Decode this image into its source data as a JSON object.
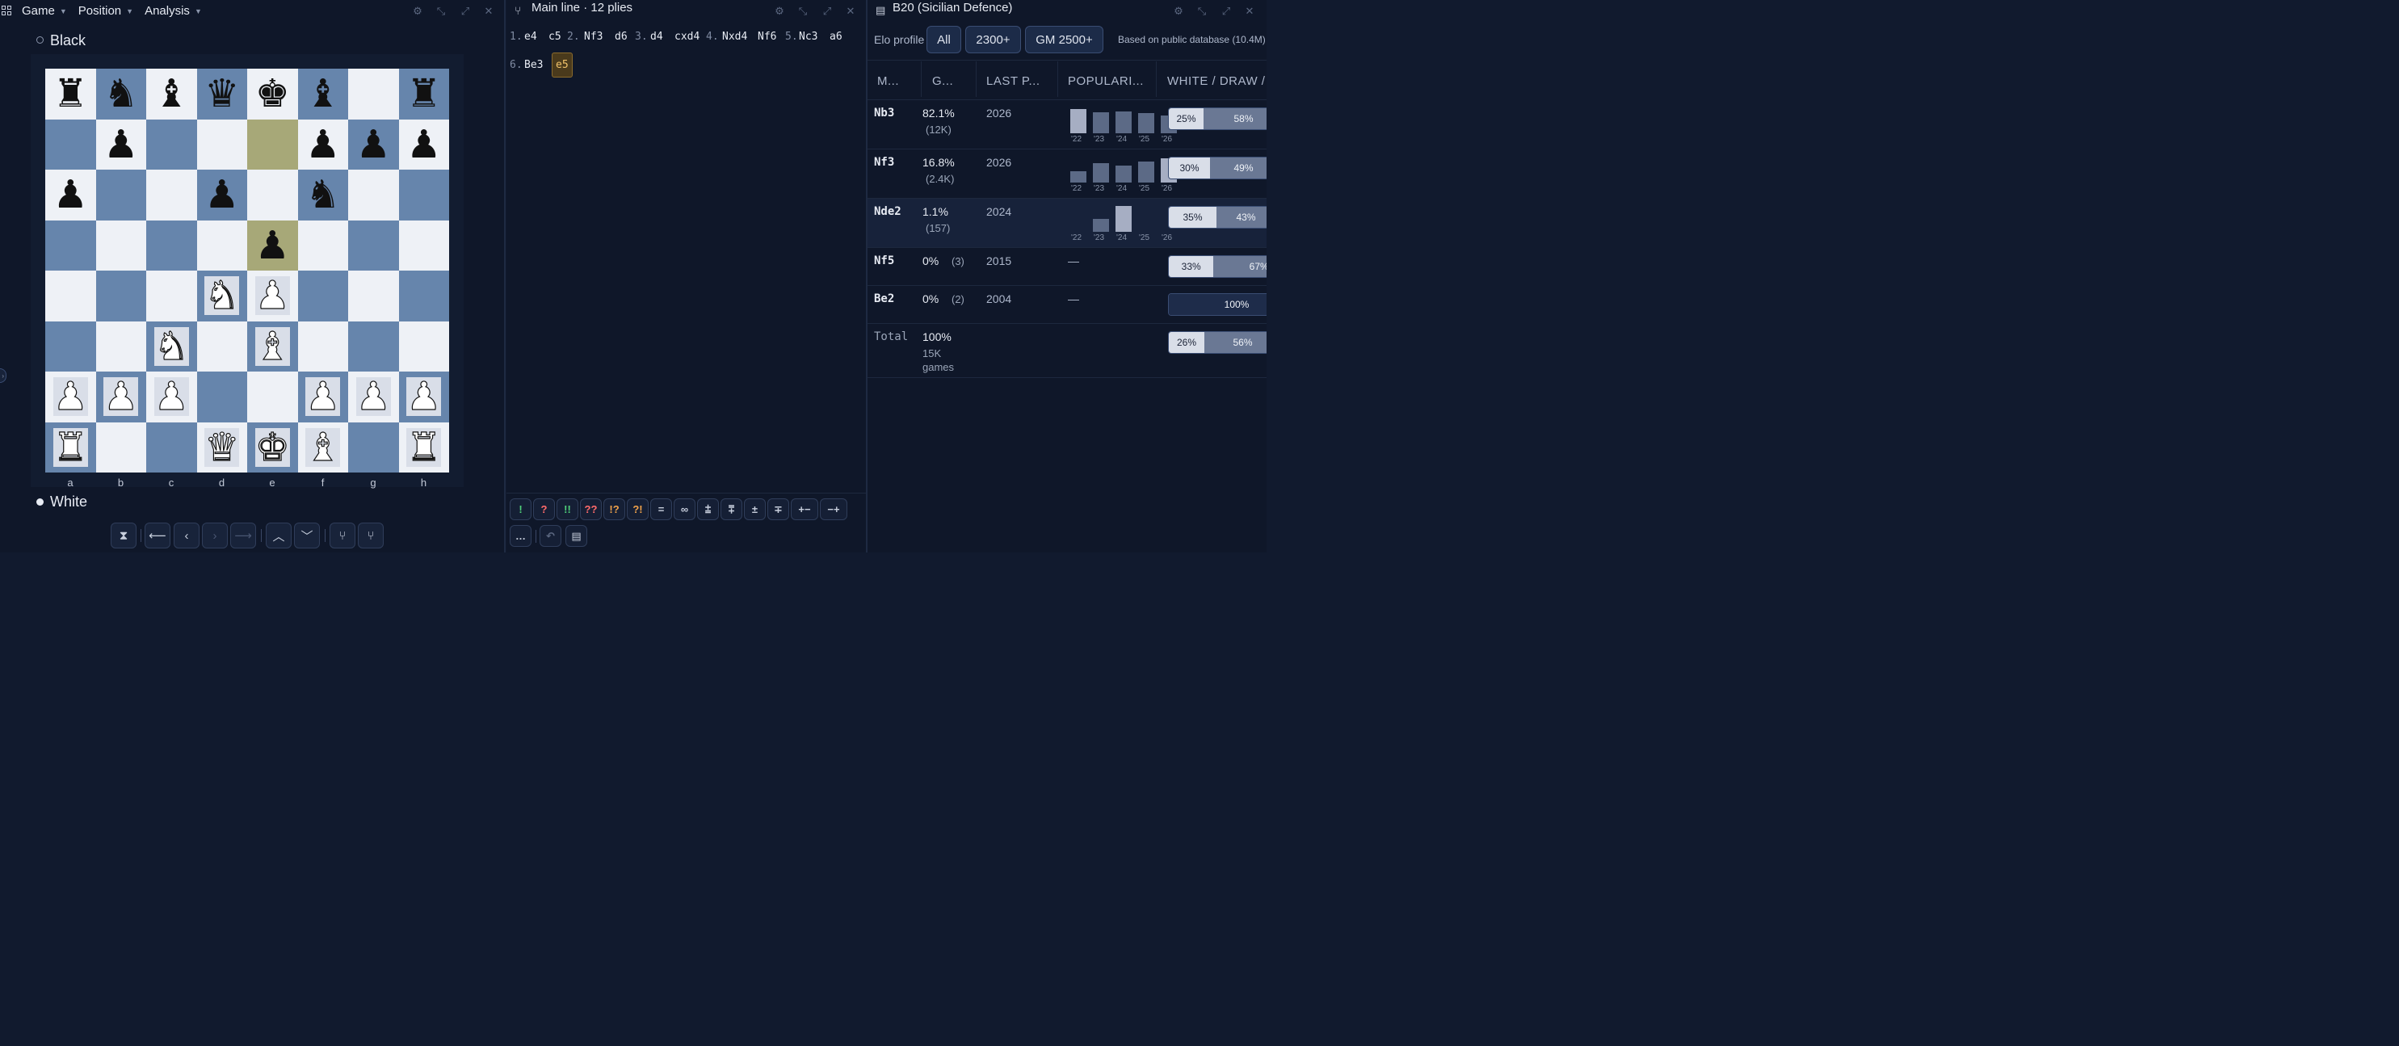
{
  "board_panel": {
    "menus": [
      "Game",
      "Position",
      "Analysis"
    ],
    "top_player": "Black",
    "bottom_player": "White",
    "ranks": [
      "8",
      "7",
      "6",
      "5",
      "4",
      "3",
      "2",
      "1"
    ],
    "files": [
      "a",
      "b",
      "c",
      "d",
      "e",
      "f",
      "g",
      "h"
    ],
    "position_rows": [
      [
        "bR",
        "bN",
        "bB",
        "bQ",
        "bK",
        "bB",
        "",
        "bR"
      ],
      [
        "",
        "bP",
        "",
        "",
        "",
        "bP",
        "bP",
        "bP"
      ],
      [
        "bP",
        "",
        "",
        "bP",
        "",
        "bN",
        "",
        ""
      ],
      [
        "",
        "",
        "",
        "",
        "bP",
        "",
        "",
        ""
      ],
      [
        "",
        "",
        "",
        "wN",
        "wP",
        "",
        "",
        ""
      ],
      [
        "",
        "",
        "wN",
        "",
        "wB",
        "",
        "",
        ""
      ],
      [
        "wP",
        "wP",
        "wP",
        "",
        "",
        "wP",
        "wP",
        "wP"
      ],
      [
        "wR",
        "",
        "",
        "wQ",
        "wK",
        "wB",
        "",
        "wR"
      ]
    ],
    "last_move_squares": [
      "e7",
      "e5"
    ],
    "nav_icons": [
      "flip-board",
      "go-start",
      "prev",
      "next",
      "go-end",
      "up-variation",
      "down-variation",
      "branch-a",
      "branch-b"
    ]
  },
  "moves_panel": {
    "title": "Main line · 12 plies",
    "moves": [
      {
        "num": "1.",
        "white": "e4",
        "black": "c5"
      },
      {
        "num": "2.",
        "white": "Nf3",
        "black": "d6"
      },
      {
        "num": "3.",
        "white": "d4",
        "black": "cxd4"
      },
      {
        "num": "4.",
        "white": "Nxd4",
        "black": "Nf6"
      },
      {
        "num": "5.",
        "white": "Nc3",
        "black": "a6"
      },
      {
        "num": "6.",
        "white": "Be3",
        "black": "e5"
      }
    ],
    "current_move": "e5",
    "annotations": [
      "!",
      "?",
      "!!",
      "??",
      "!?",
      "?!",
      "=",
      "∞",
      "⩲",
      "⩱",
      "±",
      "∓",
      "+−",
      "−+"
    ],
    "annotation_colors": [
      "#4fd07a",
      "#ff6b6b",
      "#4fd07a",
      "#ff6b6b",
      "#f0a24a",
      "#f0a24a",
      "#c8cfdd",
      "#c8cfdd",
      "#c8cfdd",
      "#c8cfdd",
      "#c8cfdd",
      "#c8cfdd",
      "#c8cfdd",
      "#c8cfdd"
    ],
    "extra_buttons": [
      "…",
      "↶",
      "comment"
    ]
  },
  "explorer_panel": {
    "title": "B20 (Sicilian Defence)",
    "elo_label": "Elo profile",
    "elo_options": [
      "All",
      "2300+",
      "GM 2500+"
    ],
    "source_note": "Based on public database (10.4M)",
    "headers": [
      "M...",
      "G...",
      "LAST P...",
      "POPULARI...",
      "WHITE / DRAW /"
    ],
    "year_labels": [
      "'22",
      "'23",
      "'24",
      "'25",
      "'26"
    ],
    "rows": [
      {
        "move": "Nb3",
        "pct": "82.1%",
        "count": "(12K)",
        "last": "2026",
        "spark": [
          0.95,
          0.8,
          0.85,
          0.78,
          0.7
        ],
        "white": "25%",
        "draw": "58%",
        "wfrac": 0.25,
        "dfrac": 0.58
      },
      {
        "move": "Nf3",
        "pct": "16.8%",
        "count": "(2.4K)",
        "last": "2026",
        "spark": [
          0.45,
          0.75,
          0.65,
          0.8,
          0.95
        ],
        "white": "30%",
        "draw": "49%",
        "wfrac": 0.3,
        "dfrac": 0.49
      },
      {
        "move": "Nde2",
        "pct": "1.1%",
        "count": "(157)",
        "last": "2024",
        "spark": [
          0,
          0.5,
          1,
          0,
          0
        ],
        "white": "35%",
        "draw": "43%",
        "wfrac": 0.35,
        "dfrac": 0.43
      },
      {
        "move": "Nf5",
        "pct": "0%",
        "count": "(3)",
        "last": "2015",
        "spark": null,
        "dash": "—",
        "white": "33%",
        "draw": "67%",
        "wfrac": 0.33,
        "dfrac": 0.67
      },
      {
        "move": "Be2",
        "pct": "0%",
        "count": "(2)",
        "last": "2004",
        "spark": null,
        "dash": "—",
        "white": "",
        "draw": "",
        "loss": "100%",
        "wfrac": 0,
        "dfrac": 0
      },
      {
        "move": "Total",
        "pct": "100%",
        "count": "15K",
        "count2": "games",
        "last": "",
        "spark": null,
        "white": "26%",
        "draw": "56%",
        "wfrac": 0.26,
        "dfrac": 0.56
      }
    ]
  }
}
